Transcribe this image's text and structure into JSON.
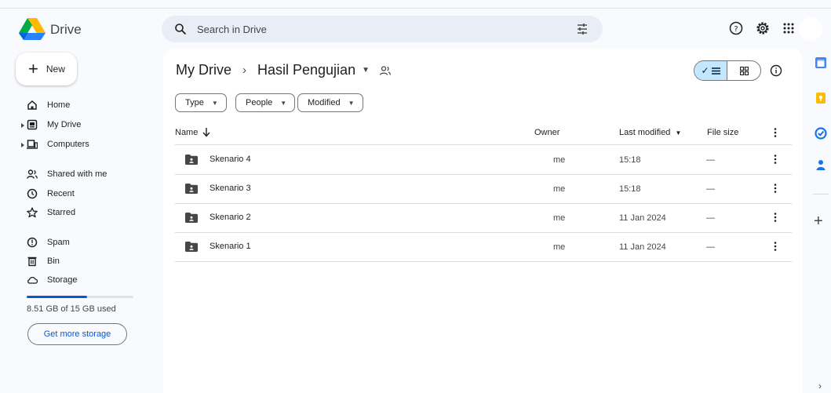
{
  "header": {
    "app_name": "Drive",
    "search_placeholder": "Search in Drive"
  },
  "sidebar": {
    "new_label": "New",
    "items": [
      {
        "label": "Home",
        "icon": "home-icon"
      },
      {
        "label": "My Drive",
        "icon": "my-drive-icon"
      },
      {
        "label": "Computers",
        "icon": "computer-icon"
      },
      {
        "label": "Shared with me",
        "icon": "people-icon"
      },
      {
        "label": "Recent",
        "icon": "clock-icon"
      },
      {
        "label": "Starred",
        "icon": "star-icon"
      },
      {
        "label": "Spam",
        "icon": "spam-icon"
      },
      {
        "label": "Bin",
        "icon": "trash-icon"
      },
      {
        "label": "Storage",
        "icon": "cloud-icon"
      }
    ],
    "storage_used_fraction": 0.567,
    "storage_text": "8.51 GB of 15 GB used",
    "get_more_storage": "Get more storage"
  },
  "main": {
    "breadcrumb": {
      "root": "My Drive",
      "current": "Hasil Pengujian"
    },
    "filters": [
      "Type",
      "People",
      "Modified"
    ],
    "columns": {
      "name": "Name",
      "owner": "Owner",
      "modified": "Last modified",
      "size": "File size"
    },
    "rows": [
      {
        "name": "Skenario 4",
        "owner": "me",
        "modified": "15:18",
        "size": "—"
      },
      {
        "name": "Skenario 3",
        "owner": "me",
        "modified": "15:18",
        "size": "—"
      },
      {
        "name": "Skenario 2",
        "owner": "me",
        "modified": "11 Jan 2024",
        "size": "—"
      },
      {
        "name": "Skenario 1",
        "owner": "me",
        "modified": "11 Jan 2024",
        "size": "—"
      }
    ]
  },
  "colors": {
    "accent": "#0b57d0",
    "search_bg": "#e9eef6",
    "selected_toggle": "#c2e7ff",
    "page_bg": "#f8fafd"
  }
}
